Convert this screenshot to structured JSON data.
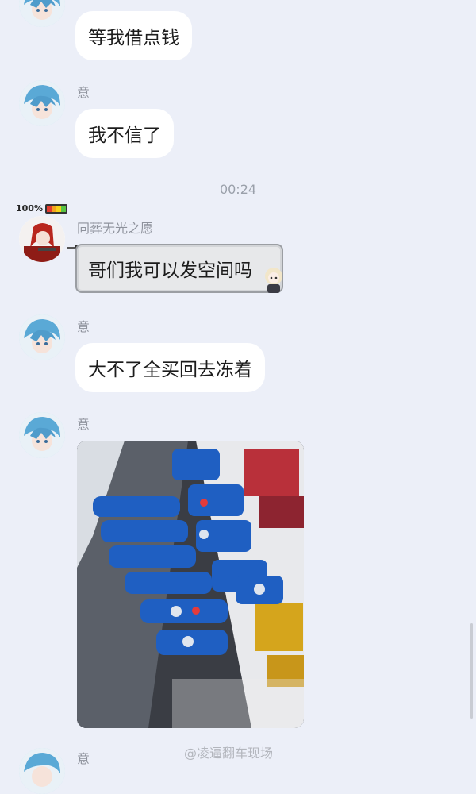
{
  "chat": {
    "messages": [
      {
        "sender": "",
        "text": "等我借点钱"
      },
      {
        "sender": "意",
        "text": "我不信了"
      },
      {
        "time": "00:24"
      },
      {
        "sender": "同葬无光之愿",
        "text": "哥们我可以发空间吗",
        "badge": "100%"
      },
      {
        "sender": "意",
        "text": "大不了全买回去冻着"
      },
      {
        "sender": "意",
        "image": "drinks-fridge-photo"
      },
      {
        "sender": "意"
      }
    ]
  },
  "watermark": "@凌逼翻车现场",
  "colors": {
    "background": "#eceff8",
    "bubble": "#ffffff",
    "name": "#8e929c"
  }
}
